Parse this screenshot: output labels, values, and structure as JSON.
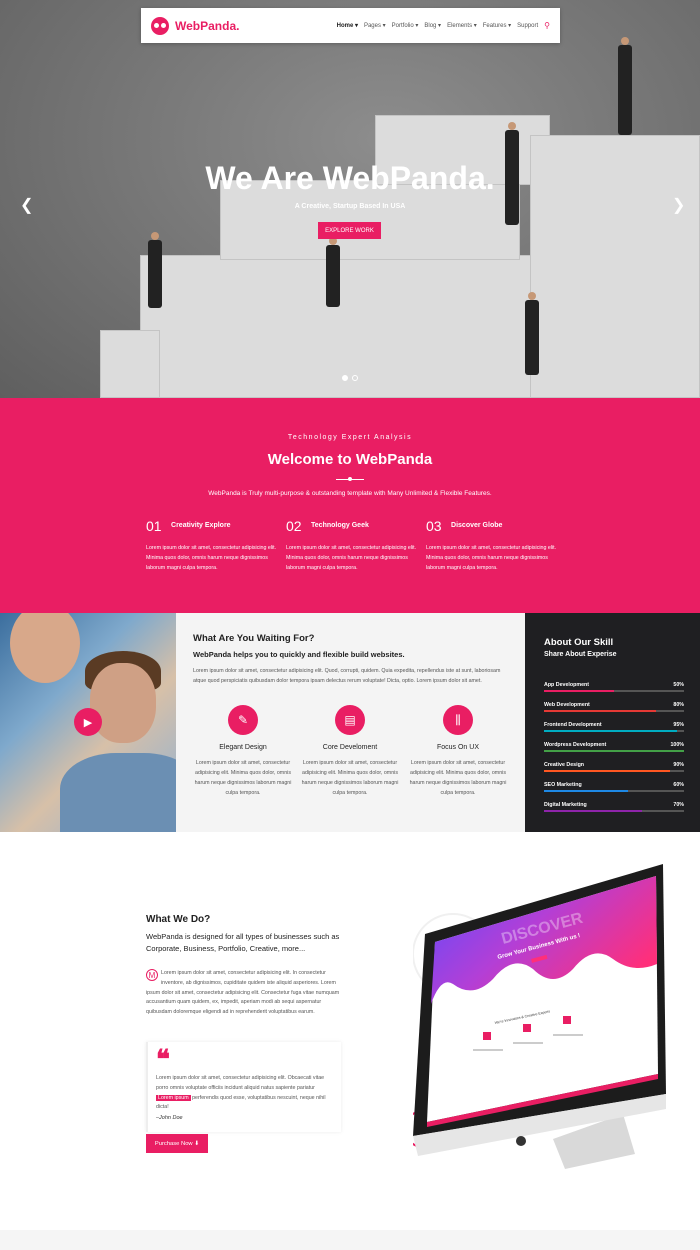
{
  "nav": {
    "brand": "WebPanda.",
    "items": [
      "Home ▾",
      "Pages ▾",
      "Portfolio ▾",
      "Blog ▾",
      "Elements ▾",
      "Features ▾",
      "Support"
    ]
  },
  "hero": {
    "title": "We Are WebPanda.",
    "subtitle": "A Creative, Startup Based In USA",
    "button": "EXPLORE WORK"
  },
  "welcome": {
    "kicker": "Technology Expert Analysis",
    "title": "Welcome to WebPanda",
    "description": "WebPanda is Truly multi-purpose & outstanding template with Many Unlimited & Flexible Features.",
    "features": [
      {
        "num": "01",
        "name": "Creativity Explore",
        "text": "Lorem ipsum dolor sit amet, consectetur adipisicing elit. Minima quos dolor, omnis harum neque dignissimos laborum magni culpa tempora."
      },
      {
        "num": "02",
        "name": "Technology Geek",
        "text": "Lorem ipsum dolor sit amet, consectetur adipisicing elit. Minima quos dolor, omnis harum neque dignissimos laborum magni culpa tempora."
      },
      {
        "num": "03",
        "name": "Discover Globe",
        "text": "Lorem ipsum dolor sit amet, consectetur adipisicing elit. Minima quos dolor, omnis harum neque dignissimos laborum magni culpa tempora."
      }
    ]
  },
  "waiting": {
    "title": "What Are You Waiting For?",
    "subtitle": "WebPanda helps you to quickly and flexible build websites.",
    "paragraph": "Lorem ipsum dolor sit amet, consectetur adipisicing elit. Quod, corrupti, quidem. Quia expedita, repellendus iste at sunt, laboriosam atque quod perspiciatis quibusdam dolor tempora ipsam delectus rerum voluptate! Dicta, optio. Lorem ipsum dolor sit amet.",
    "services": [
      {
        "icon": "✎",
        "title": "Elegant Design",
        "text": "Lorem ipsum dolor sit amet, consectetur adipisicing elit. Minima quos dolor, omnis harum neque dignissimos laborum magni culpa tempora."
      },
      {
        "icon": "▤",
        "title": "Core Develoment",
        "text": "Lorem ipsum dolor sit amet, consectetur adipisicing elit. Minima quos dolor, omnis harum neque dignissimos laborum magni culpa tempora."
      },
      {
        "icon": "⫼",
        "title": "Focus On UX",
        "text": "Lorem ipsum dolor sit amet, consectetur adipisicing elit. Minima quos dolor, omnis harum neque dignissimos laborum magni culpa tempora."
      }
    ]
  },
  "skills": {
    "title": "About Our Skill",
    "subtitle": "Share About Experise",
    "items": [
      {
        "name": "App Development",
        "percent": "50%",
        "value": 50,
        "color": "#e91e63"
      },
      {
        "name": "Web Development",
        "percent": "80%",
        "value": 80,
        "color": "#e53935"
      },
      {
        "name": "Frontend Development",
        "percent": "95%",
        "value": 95,
        "color": "#00acc1"
      },
      {
        "name": "Wordpress Development",
        "percent": "100%",
        "value": 100,
        "color": "#43a047"
      },
      {
        "name": "Creative Design",
        "percent": "90%",
        "value": 90,
        "color": "#ff5722"
      },
      {
        "name": "SEO Marketing",
        "percent": "60%",
        "value": 60,
        "color": "#1e88e5"
      },
      {
        "name": "Digital Marketing",
        "percent": "70%",
        "value": 70,
        "color": "#8e24aa"
      }
    ]
  },
  "whatwedo": {
    "title": "What We Do?",
    "lead": "WebPanda is designed for all types of businesses such as Corporate, Business, Portfolio, Creative, more...",
    "dropcap": "M",
    "paragraph": "Lorem ipsum dolor sit amet, consectetur adipisicing elit. In consectetur inventore, ab dignissimos, cupiditate quidem iste aliquid asperiores. Lorem ipsum dolor sit amet, consectetur adipisicing elit. Consectetur fuga vitae numquam accusantium quam quidem, ex, impedit, aperiam modi ab sequi aspernatur quibusdam doloremque eligendi ad in reprehenderit voluptatibus earum.",
    "quote_before": "Lorem ipsum dolor sit amet, consectetur adipisicing elit. Obcaecati vitae porro omnis voluptate officiis incidunt aliquid natus sapiente pariatur",
    "quote_highlight": "Lorem ipsum",
    "quote_after": "perferendis quod esse, voluptatibus nescuint, neque nihil dicta!",
    "author": "–John Doe",
    "button": "Purchase Now ⬇",
    "screen_title": "DISCOVER",
    "screen_sub": "Grow Your Business With us !",
    "screen_section": "We're Innovators & Creative Experts"
  }
}
